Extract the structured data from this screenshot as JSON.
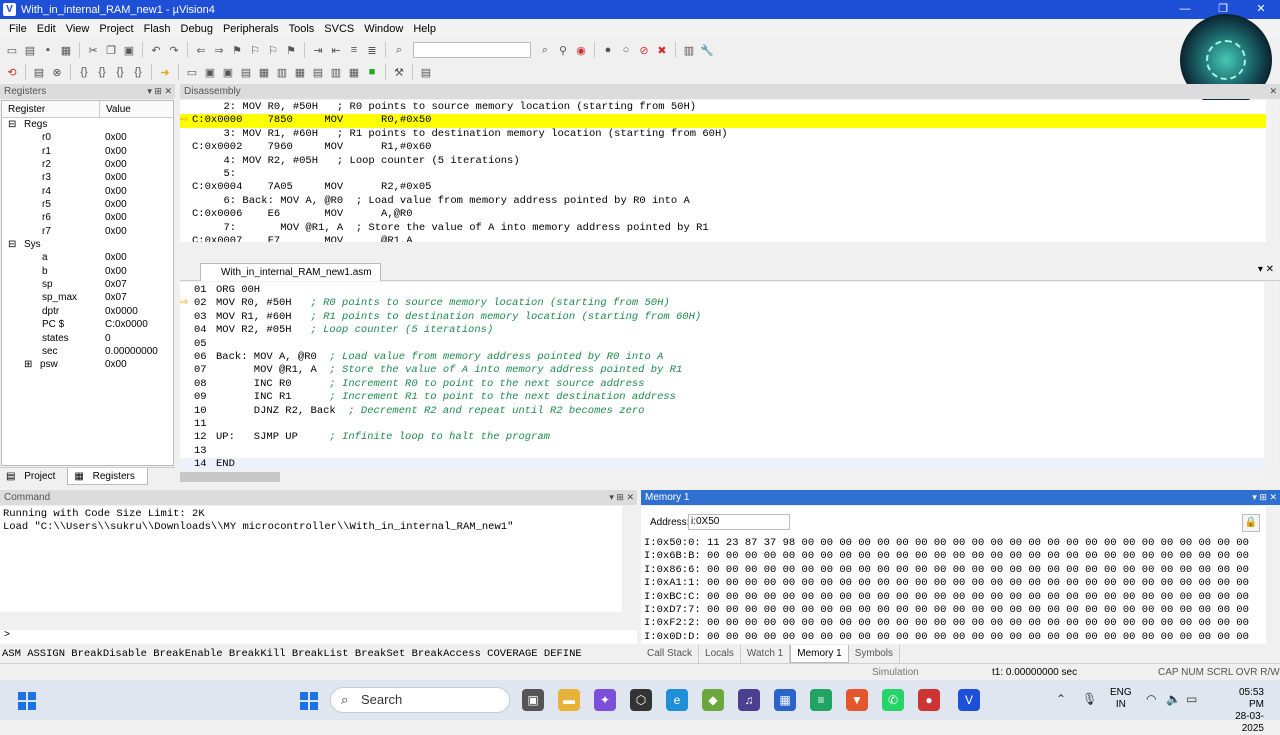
{
  "window": {
    "title": "With_in_internal_RAM_new1 - µVision4",
    "min": "—",
    "restore": "❐",
    "close": "✕"
  },
  "menu": [
    "File",
    "Edit",
    "View",
    "Project",
    "Flash",
    "Debug",
    "Peripherals",
    "Tools",
    "SVCS",
    "Window",
    "Help"
  ],
  "registers": {
    "header": "Registers",
    "col_register": "Register",
    "col_value": "Value",
    "rows": [
      {
        "name": "Regs",
        "value": "",
        "level": 0,
        "tree": "⊟"
      },
      {
        "name": "r0",
        "value": "0x00",
        "level": 2
      },
      {
        "name": "r1",
        "value": "0x00",
        "level": 2
      },
      {
        "name": "r2",
        "value": "0x00",
        "level": 2
      },
      {
        "name": "r3",
        "value": "0x00",
        "level": 2
      },
      {
        "name": "r4",
        "value": "0x00",
        "level": 2
      },
      {
        "name": "r5",
        "value": "0x00",
        "level": 2
      },
      {
        "name": "r6",
        "value": "0x00",
        "level": 2
      },
      {
        "name": "r7",
        "value": "0x00",
        "level": 2
      },
      {
        "name": "Sys",
        "value": "",
        "level": 0,
        "tree": "⊟"
      },
      {
        "name": "a",
        "value": "0x00",
        "level": 2
      },
      {
        "name": "b",
        "value": "0x00",
        "level": 2
      },
      {
        "name": "sp",
        "value": "0x07",
        "level": 2
      },
      {
        "name": "sp_max",
        "value": "0x07",
        "level": 2
      },
      {
        "name": "dptr",
        "value": "0x0000",
        "level": 2
      },
      {
        "name": "PC  $",
        "value": "C:0x0000",
        "level": 2
      },
      {
        "name": "states",
        "value": "0",
        "level": 2
      },
      {
        "name": "sec",
        "value": "0.00000000",
        "level": 2
      },
      {
        "name": "psw",
        "value": "0x00",
        "level": 1,
        "tree": "⊞"
      }
    ],
    "tabs": [
      "Project",
      "Registers"
    ]
  },
  "disassembly": {
    "header": "Disassembly",
    "lines": [
      {
        "text": "     2: MOV R0, #50H   ; R0 points to source memory location (starting from 50H)",
        "hl": false
      },
      {
        "text": "C:0x0000    7850     MOV      R0,#0x50",
        "hl": true
      },
      {
        "text": "     3: MOV R1, #60H   ; R1 points to destination memory location (starting from 60H)",
        "hl": false
      },
      {
        "text": "C:0x0002    7960     MOV      R1,#0x60",
        "hl": false
      },
      {
        "text": "     4: MOV R2, #05H   ; Loop counter (5 iterations)",
        "hl": false
      },
      {
        "text": "     5: ",
        "hl": false
      },
      {
        "text": "C:0x0004    7A05     MOV      R2,#0x05",
        "hl": false
      },
      {
        "text": "     6: Back: MOV A, @R0  ; Load value from memory address pointed by R0 into A",
        "hl": false
      },
      {
        "text": "C:0x0006    E6       MOV      A,@R0",
        "hl": false
      },
      {
        "text": "     7:       MOV @R1, A  ; Store the value of A into memory address pointed by R1",
        "hl": false
      },
      {
        "text": "C:0x0007    F7       MOV      @R1,A",
        "hl": false
      }
    ]
  },
  "editor": {
    "tab": "With_in_internal_RAM_new1.asm",
    "lines": [
      {
        "n": "01",
        "code": "ORG 00H"
      },
      {
        "n": "02",
        "code": "MOV R0, #50H   ; R0 points to source memory location (starting from 50H)",
        "arrow": true
      },
      {
        "n": "03",
        "code": "MOV R1, #60H   ; R1 points to destination memory location (starting from 60H)"
      },
      {
        "n": "04",
        "code": "MOV R2, #05H   ; Loop counter (5 iterations)"
      },
      {
        "n": "05",
        "code": ""
      },
      {
        "n": "06",
        "code": "Back: MOV A, @R0  ; Load value from memory address pointed by R0 into A"
      },
      {
        "n": "07",
        "code": "      MOV @R1, A  ; Store the value of A into memory address pointed by R1"
      },
      {
        "n": "08",
        "code": "      INC R0      ; Increment R0 to point to the next source address"
      },
      {
        "n": "09",
        "code": "      INC R1      ; Increment R1 to point to the next destination address"
      },
      {
        "n": "10",
        "code": "      DJNZ R2, Back  ; Decrement R2 and repeat until R2 becomes zero"
      },
      {
        "n": "11",
        "code": ""
      },
      {
        "n": "12",
        "code": "UP:   SJMP UP     ; Infinite loop to halt the program"
      },
      {
        "n": "13",
        "code": ""
      },
      {
        "n": "14",
        "code": "END",
        "cur": true
      }
    ]
  },
  "command": {
    "header": "Command",
    "output": "Running with Code Size Limit: 2K\nLoad \"C:\\\\Users\\\\sukru\\\\Downloads\\\\MY microcontroller\\\\With_in_internal_RAM_new1\"",
    "prompt": ">",
    "help": "ASM ASSIGN BreakDisable BreakEnable BreakKill BreakList BreakSet BreakAccess COVERAGE DEFINE"
  },
  "memory": {
    "header": "Memory 1",
    "address_label": "Address:",
    "address_value": "i:0X50",
    "lines": [
      "I:0x50:0: 11 23 87 37 98 00 00 00 00 00 00 00 00 00 00 00 00 00 00 00 00 00 00 00 00 00 00 00 00",
      "I:0x6B:B: 00 00 00 00 00 00 00 00 00 00 00 00 00 00 00 00 00 00 00 00 00 00 00 00 00 00 00 00 00",
      "I:0x86:6: 00 00 00 00 00 00 00 00 00 00 00 00 00 00 00 00 00 00 00 00 00 00 00 00 00 00 00 00 00",
      "I:0xA1:1: 00 00 00 00 00 00 00 00 00 00 00 00 00 00 00 00 00 00 00 00 00 00 00 00 00 00 00 00 00",
      "I:0xBC:C: 00 00 00 00 00 00 00 00 00 00 00 00 00 00 00 00 00 00 00 00 00 00 00 00 00 00 00 00 00",
      "I:0xD7:7: 00 00 00 00 00 00 00 00 00 00 00 00 00 00 00 00 00 00 00 00 00 00 00 00 00 00 00 00 00",
      "I:0xF2:2: 00 00 00 00 00 00 00 00 00 00 00 00 00 00 00 00 00 00 00 00 00 00 00 00 00 00 00 00 00",
      "I:0x0D:D: 00 00 00 00 00 00 00 00 00 00 00 00 00 00 00 00 00 00 00 00 00 00 00 00 00 00 00 00 00"
    ],
    "tabs": [
      "Call Stack",
      "Locals",
      "Watch 1",
      "Memory 1",
      "Symbols"
    ]
  },
  "status": {
    "mode": "Simulation",
    "t1": "t1: 0.00000000 sec",
    "keys": "CAP  NUM  SCRL  OVR  R/W"
  },
  "taskbar": {
    "search": "Search",
    "lang1": "ENG",
    "lang2": "IN",
    "time": "05:53 PM",
    "date": "28-03-2025"
  }
}
